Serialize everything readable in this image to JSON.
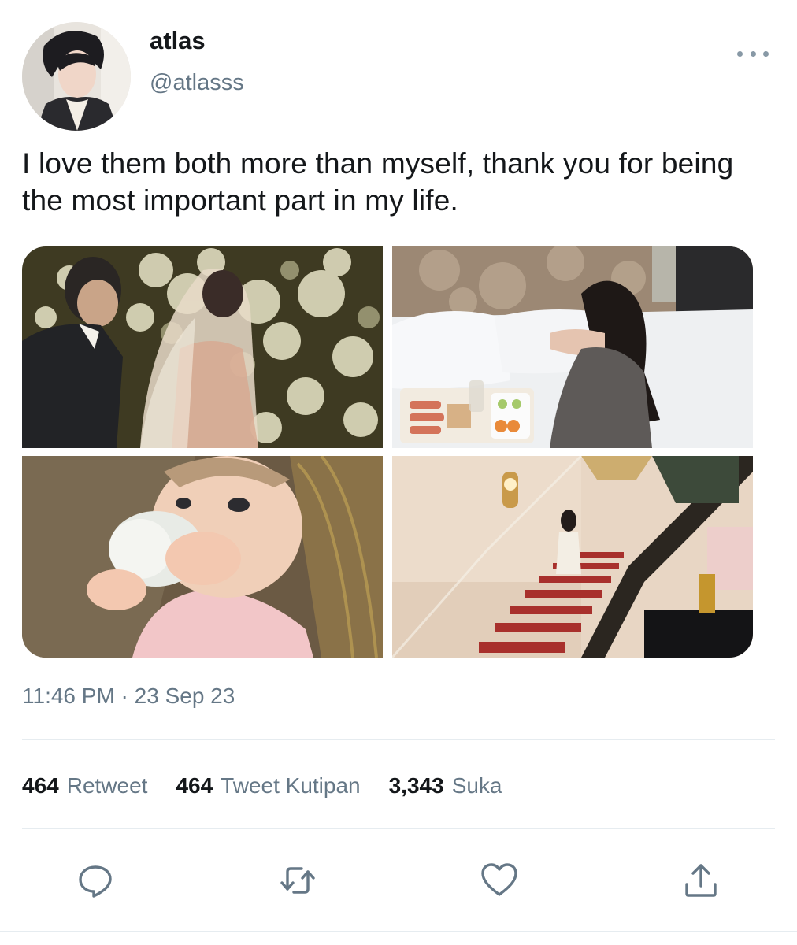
{
  "author": {
    "display_name": "atlas",
    "handle": "@atlasss"
  },
  "tweet": {
    "text": "I love them both more than myself, thank you for being the most important part in my life.",
    "timestamp": "11:46 PM · 23 Sep 23"
  },
  "media": [
    {
      "description_icon": "wedding-photo"
    },
    {
      "description_icon": "bed-breakfast-photo"
    },
    {
      "description_icon": "baby-bottle-photo"
    },
    {
      "description_icon": "grand-staircase-photo"
    }
  ],
  "stats": {
    "retweets_count": "464",
    "retweets_label": "Retweet",
    "quotes_count": "464",
    "quotes_label": "Tweet Kutipan",
    "likes_count": "3,343",
    "likes_label": "Suka"
  },
  "actions": {
    "reply_icon": "reply-icon",
    "retweet_icon": "retweet-icon",
    "like_icon": "heart-icon",
    "share_icon": "share-icon"
  },
  "colors": {
    "text_primary": "#14171a",
    "text_secondary": "#657786",
    "icon": "#657786",
    "divider": "#e6ecf0"
  }
}
